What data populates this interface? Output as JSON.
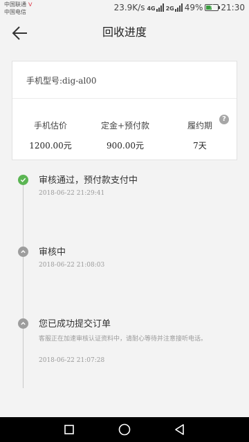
{
  "status_bar": {
    "carrier_1": "中国联通",
    "carrier_2": "中国电信",
    "speed": "23.9K/s",
    "network_1": "4G",
    "network_2": "2G",
    "battery": "49%",
    "battery_level": 0.49,
    "time": "21:30"
  },
  "header": {
    "title": "回收进度"
  },
  "card": {
    "model": "手机型号:dig-al00",
    "stats": [
      {
        "label": "手机估价",
        "value": "1200.00元"
      },
      {
        "label": "定金+预付款",
        "value": "900.00元"
      },
      {
        "label": "履约期",
        "value": "7天"
      }
    ],
    "help_icon": "help-icon"
  },
  "timeline": [
    {
      "title": "审核通过，预付款支付中",
      "time": "2018-06-22 21:29:41",
      "status": "done"
    },
    {
      "title": "审核中",
      "time": "2018-06-22 21:08:03",
      "status": "pending"
    },
    {
      "title": "您已成功提交订单",
      "desc": "客服正在加速审核认证资料中，请耐心等待并注意接听电话。",
      "time": "2018-06-22 21:07:28",
      "status": "pending"
    }
  ],
  "colors": {
    "done": "#5bb553",
    "pending": "#9d9d9d",
    "background": "#f3f3f3"
  },
  "nav_bar": {
    "icons": [
      "recent-apps-icon",
      "home-icon",
      "back-icon"
    ]
  }
}
